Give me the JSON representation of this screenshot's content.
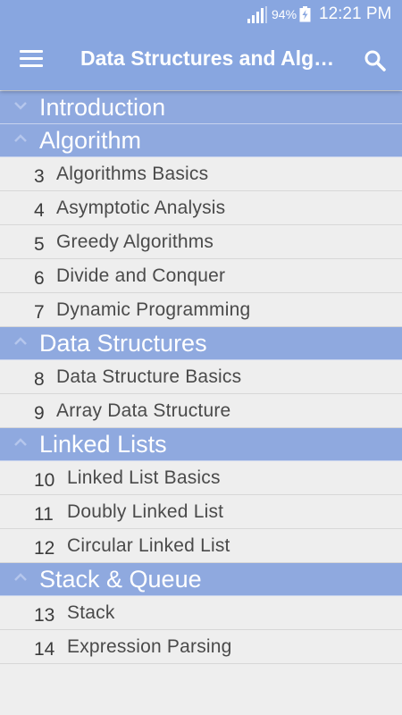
{
  "status_bar": {
    "battery": "94%",
    "time": "12:21 PM",
    "icons": [
      "signal-icon",
      "battery-charging-icon"
    ]
  },
  "app_bar": {
    "title": "Data Structures and Algorithms",
    "menu_icon": "hamburger-menu-icon",
    "search_icon": "search-icon"
  },
  "sections": [
    {
      "label": "Introduction",
      "state": "collapsed",
      "items": []
    },
    {
      "label": "Algorithm",
      "state": "expanded",
      "items": [
        {
          "num": "3",
          "text": "Algorithms Basics"
        },
        {
          "num": "4",
          "text": "Asymptotic Analysis"
        },
        {
          "num": "5",
          "text": "Greedy Algorithms"
        },
        {
          "num": "6",
          "text": "Divide and Conquer"
        },
        {
          "num": "7",
          "text": "Dynamic Programming"
        }
      ]
    },
    {
      "label": "Data Structures",
      "state": "expanded",
      "items": [
        {
          "num": "8",
          "text": "Data Structure Basics"
        },
        {
          "num": "9",
          "text": "Array Data Structure"
        }
      ]
    },
    {
      "label": "Linked Lists",
      "state": "expanded",
      "items": [
        {
          "num": "10",
          "text": "Linked List Basics"
        },
        {
          "num": "11",
          "text": "Doubly Linked List"
        },
        {
          "num": "12",
          "text": "Circular Linked List"
        }
      ]
    },
    {
      "label": "Stack & Queue",
      "state": "expanded",
      "items": [
        {
          "num": "13",
          "text": "Stack"
        },
        {
          "num": "14",
          "text": "Expression Parsing"
        }
      ]
    }
  ],
  "colors": {
    "app_bar": "#88a6e0",
    "section_header": "#8fa9df",
    "background": "#eeeeee"
  }
}
